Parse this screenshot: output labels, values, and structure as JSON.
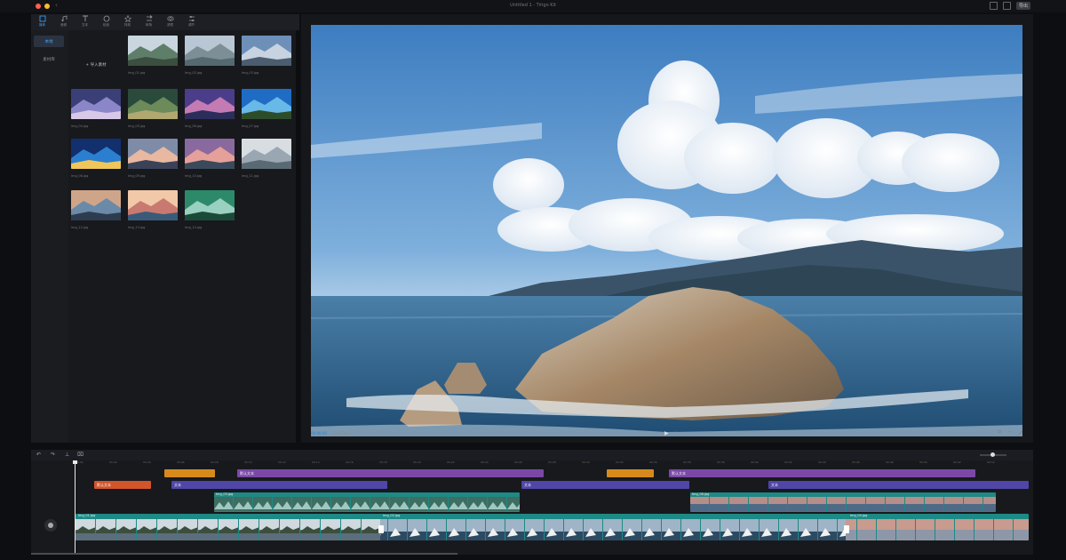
{
  "titlebar": {
    "back": "‹",
    "title": "Untitled 1 - Tirigo Kit",
    "share_label": "导出"
  },
  "tabs": [
    {
      "label": "媒体",
      "icon": "media-icon",
      "active": true
    },
    {
      "label": "音频",
      "icon": "music-icon",
      "active": false
    },
    {
      "label": "文本",
      "icon": "text-icon",
      "active": false
    },
    {
      "label": "贴纸",
      "icon": "sticker-icon",
      "active": false
    },
    {
      "label": "特效",
      "icon": "effects-icon",
      "active": false
    },
    {
      "label": "转场",
      "icon": "transition-icon",
      "active": false
    },
    {
      "label": "滤镜",
      "icon": "filter-icon",
      "active": false
    },
    {
      "label": "调节",
      "icon": "adjust-icon",
      "active": false
    }
  ],
  "side_nav": [
    {
      "label": "本地",
      "active": true
    },
    {
      "label": "素材库",
      "active": false
    }
  ],
  "media": {
    "import_label": "+ 导入素材",
    "items": [
      {
        "name": "Img_01.jpg"
      },
      {
        "name": "Img_02.jpg"
      },
      {
        "name": "Img_03.jpg"
      },
      {
        "name": "Img_04.jpg"
      },
      {
        "name": "Img_05.jpg"
      },
      {
        "name": "Img_06.jpg"
      },
      {
        "name": "Img_07.jpg"
      },
      {
        "name": "Img_08.jpg"
      },
      {
        "name": "Img_09.jpg"
      },
      {
        "name": "Img_10.jpg"
      },
      {
        "name": "Img_11.jpg"
      },
      {
        "name": "Img_12.jpg"
      },
      {
        "name": "Img_13.jpg"
      },
      {
        "name": "Img_14.jpg"
      }
    ]
  },
  "preview": {
    "current_time": "00:00:00",
    "total_time": "/ 00:13:07",
    "play_icon": "▶",
    "right_controls": [
      "⊡",
      "⋯",
      "⤢"
    ]
  },
  "timeline": {
    "tools": [
      "↶",
      "↷",
      "⊥",
      "⌧"
    ],
    "ruler_ticks": [
      "00:00",
      "00:02",
      "00:04",
      "00:06",
      "00:08",
      "00:10",
      "00:12",
      "00:14",
      "00:16",
      "00:18",
      "00:20",
      "00:22",
      "00:24",
      "00:26",
      "00:28",
      "00:30",
      "00:32",
      "00:34",
      "00:36",
      "00:38",
      "00:40",
      "00:42",
      "00:44",
      "00:46",
      "00:48",
      "00:50",
      "00:52",
      "00:54"
    ],
    "clips": {
      "orange1": "",
      "orange2": "",
      "red1": "默认文本",
      "purple1": "默认文本",
      "purple2": "默认文本",
      "blue1": "文本",
      "blue2": "文本",
      "blue3": "文本",
      "v1": "Img_03.jpg",
      "v2": "Img_08.jpg",
      "main1": "Img_01.jpg",
      "main2": "Img_02.jpg",
      "main3": "Img_04.jpg"
    }
  }
}
